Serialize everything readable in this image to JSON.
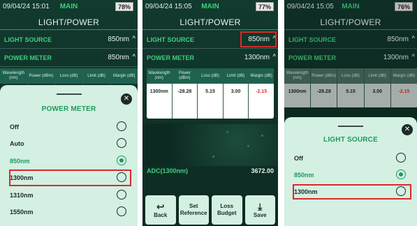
{
  "panel1": {
    "status": {
      "date": "09/04/24 15:01",
      "mode": "MAIN",
      "battery": "78%"
    },
    "title": "LIGHT/POWER",
    "light_source": {
      "label": "LIGHT SOURCE",
      "value": "850nm"
    },
    "power_meter": {
      "label": "POWER METER",
      "value": "850nm"
    },
    "table_headers": [
      "Wavelength (nm)",
      "Power (dBm)",
      "Loss (dB)",
      "Limit (dB)",
      "Margin (dB)"
    ],
    "sheet": {
      "title": "POWER METER",
      "options": [
        {
          "label": "Off",
          "selected": false
        },
        {
          "label": "Auto",
          "selected": false
        },
        {
          "label": "850nm",
          "selected": true
        },
        {
          "label": "1300nm",
          "selected": false
        },
        {
          "label": "1310nm",
          "selected": false
        },
        {
          "label": "1550nm",
          "selected": false
        }
      ]
    }
  },
  "panel2": {
    "status": {
      "date": "09/04/24 15:05",
      "mode": "MAIN",
      "battery": "77%"
    },
    "title": "LIGHT/POWER",
    "light_source": {
      "label": "LIGHT SOURCE",
      "value": "850nm"
    },
    "power_meter": {
      "label": "POWER METER",
      "value": "1300nm"
    },
    "table_headers": [
      "Wavelength (nm)",
      "Power (dBm)",
      "Loss (dB)",
      "Limit (dB)",
      "Margin (dB)"
    ],
    "table_row": [
      "1300nm",
      "-28.28",
      "5.15",
      "3.00",
      "-2.15"
    ],
    "adc": {
      "label": "ADC(1300nm)",
      "value": "3672.00"
    },
    "toolbar": {
      "back": "Back",
      "set_reference": "Set Reference",
      "loss_budget": "Loss Budget",
      "save": "Save"
    }
  },
  "panel3": {
    "status": {
      "date": "09/04/24 15:05",
      "mode": "MAIN",
      "battery": "76%"
    },
    "title": "LIGHT/POWER",
    "light_source": {
      "label": "LIGHT SOURCE",
      "value": "850nm"
    },
    "power_meter": {
      "label": "POWER METER",
      "value": "1300nm"
    },
    "table_headers": [
      "Wavelength (nm)",
      "Power (dBm)",
      "Loss (dB)",
      "Limit (dB)",
      "Margin (dB)"
    ],
    "table_row": [
      "1300nm",
      "-28.28",
      "5.15",
      "3.00",
      "-2.15"
    ],
    "sheet": {
      "title": "LIGHT SOURCE",
      "options": [
        {
          "label": "Off",
          "selected": false
        },
        {
          "label": "850nm",
          "selected": true
        },
        {
          "label": "1300nm",
          "selected": false
        }
      ]
    }
  },
  "colors": {
    "accent": "#1f9a5c",
    "highlight": "#d82a2a",
    "background": "#123a2f",
    "sheet": "#d3f0e2"
  },
  "icons": {
    "close": "close-icon",
    "back": "back-arrow-icon",
    "save": "download-icon",
    "chevron": "chevron-up-icon"
  }
}
